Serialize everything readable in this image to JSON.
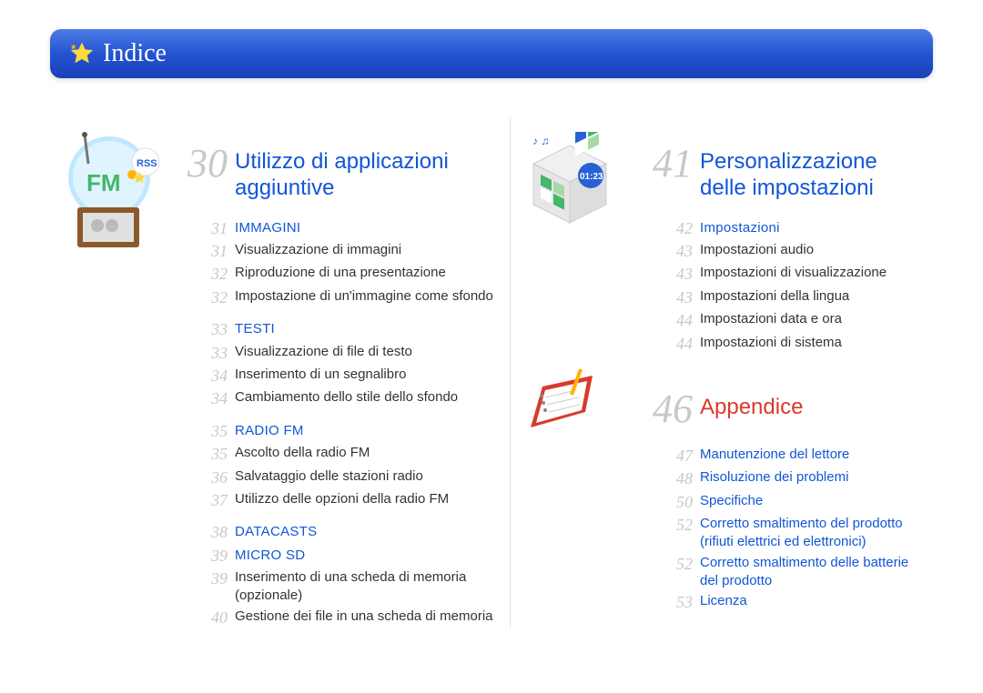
{
  "header": {
    "title": "Indice"
  },
  "left": {
    "section": {
      "num": "30",
      "title": "Utilizzo di applicazioni aggiuntive"
    },
    "groups": [
      {
        "head": {
          "num": "31",
          "label": "IMMAGINI"
        },
        "items": [
          {
            "num": "31",
            "text": "Visualizzazione di immagini"
          },
          {
            "num": "32",
            "text": "Riproduzione di una presentazione"
          },
          {
            "num": "32",
            "text": "Impostazione di un'immagine come sfondo"
          }
        ]
      },
      {
        "head": {
          "num": "33",
          "label": "TESTI"
        },
        "items": [
          {
            "num": "33",
            "text": "Visualizzazione di file di testo"
          },
          {
            "num": "34",
            "text": "Inserimento di un segnalibro"
          },
          {
            "num": "34",
            "text": "Cambiamento dello stile dello sfondo"
          }
        ]
      },
      {
        "head": {
          "num": "35",
          "label": "RADIO FM"
        },
        "items": [
          {
            "num": "35",
            "text": "Ascolto della radio FM"
          },
          {
            "num": "36",
            "text": "Salvataggio delle stazioni radio"
          },
          {
            "num": "37",
            "text": "Utilizzo delle opzioni della radio FM"
          }
        ]
      },
      {
        "head": {
          "num": "38",
          "label": "DATACASTS"
        },
        "items": []
      },
      {
        "head": {
          "num": "39",
          "label": "MICRO SD"
        },
        "items": [
          {
            "num": "39",
            "text": "Inserimento di una scheda di memoria (opzionale)"
          },
          {
            "num": "40",
            "text": "Gestione dei file in una scheda di memoria"
          }
        ]
      }
    ]
  },
  "right_top": {
    "section": {
      "num": "41",
      "title": "Personalizzazione delle impostazioni"
    },
    "groups": [
      {
        "head": {
          "num": "42",
          "label": "Impostazioni"
        },
        "items": [
          {
            "num": "43",
            "text": "Impostazioni audio"
          },
          {
            "num": "43",
            "text": "Impostazioni di visualizzazione"
          },
          {
            "num": "43",
            "text": "Impostazioni della lingua"
          },
          {
            "num": "44",
            "text": "Impostazioni data e ora"
          },
          {
            "num": "44",
            "text": "Impostazioni di sistema"
          }
        ]
      }
    ]
  },
  "right_bottom": {
    "section": {
      "num": "46",
      "title": "Appendice"
    },
    "items": [
      {
        "num": "47",
        "text": "Manutenzione del lettore"
      },
      {
        "num": "48",
        "text": "Risoluzione dei problemi"
      },
      {
        "num": "50",
        "text": "Specifiche"
      },
      {
        "num": "52",
        "text": "Corretto smaltimento del prodotto (rifiuti elettrici ed elettronici)"
      },
      {
        "num": "52",
        "text": "Corretto smaltimento delle batterie del prodotto"
      },
      {
        "num": "53",
        "text": "Licenza"
      }
    ]
  }
}
